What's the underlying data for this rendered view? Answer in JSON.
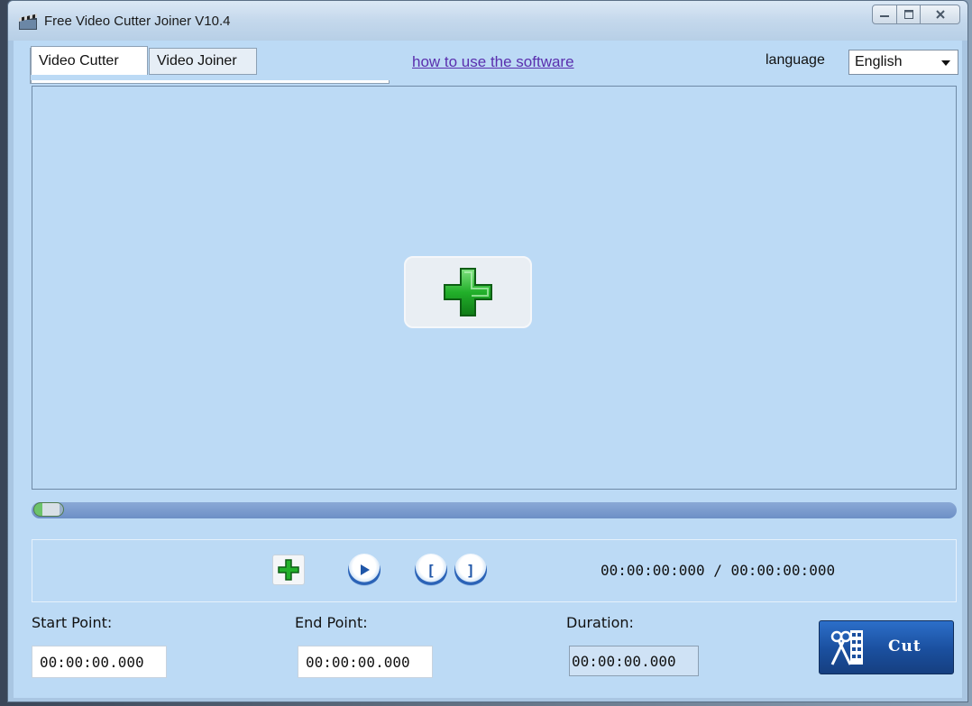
{
  "window": {
    "title": "Free Video Cutter Joiner V10.4",
    "controls": {
      "minimize_icon": "minimize-icon",
      "maximize_icon": "maximize-icon",
      "close_icon": "close-icon"
    }
  },
  "tabs": [
    {
      "label": "Video Cutter",
      "active": true
    },
    {
      "label": "Video Joiner",
      "active": false
    }
  ],
  "help_link": "how to use the software",
  "language": {
    "label": "language",
    "selected": "English"
  },
  "preview": {
    "add_icon": "plus-icon"
  },
  "progress": {
    "position": 0
  },
  "player": {
    "add_icon": "plus-icon",
    "play_icon": "play-icon",
    "mark_in_glyph": "[",
    "mark_out_glyph": "]",
    "timecode": "00:00:00:000 / 00:00:00:000"
  },
  "fields": {
    "start": {
      "label": "Start Point:",
      "value": "00:00:00.000"
    },
    "end": {
      "label": "End Point:",
      "value": "00:00:00.000"
    },
    "duration": {
      "label": "Duration:",
      "value": "00:00:00.000"
    }
  },
  "cut_button": {
    "label": "Cut",
    "icon": "scissors-film-icon"
  },
  "colors": {
    "client_bg": "#bcdaf5",
    "accent": "#1a4f9e",
    "plus_green": "#22a52a",
    "link": "#5a2fae"
  }
}
